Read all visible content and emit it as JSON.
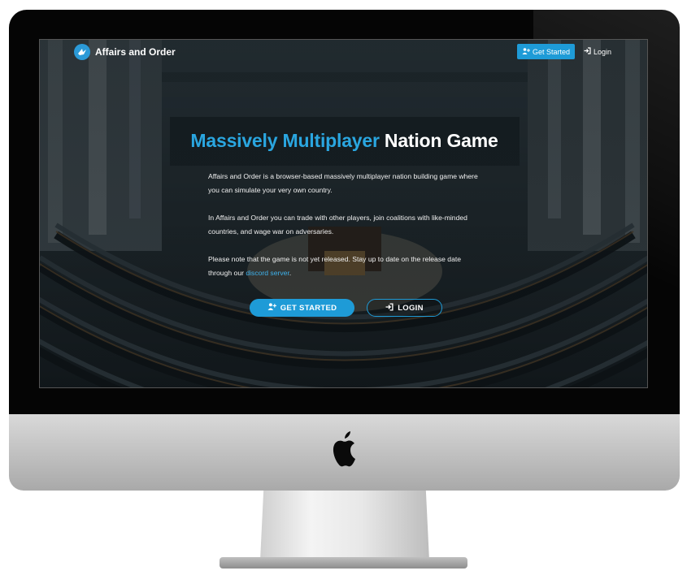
{
  "nav": {
    "brand": "Affairs and Order",
    "get_started": "Get Started",
    "login": "Login"
  },
  "hero": {
    "title_accent": "Massively Multiplayer",
    "title_rest": " Nation Game",
    "p1": "Affairs and Order is a browser-based massively multiplayer nation building game where you can simulate your very own country.",
    "p2": "In Affairs and Order you can trade with other players, join coalitions with like-minded countries, and wage war on adversaries.",
    "p3_before": "Please note that the game is not yet released. Stay up to date on the release date through our ",
    "p3_link": "discord server",
    "p3_after": ".",
    "cta_get_started": "GET STARTED",
    "cta_login": "LOGIN"
  },
  "icons": {
    "brand": "dove-logo-icon",
    "get_started": "user-plus-icon",
    "login": "sign-in-icon",
    "hardware": "apple-logo-icon"
  },
  "colors": {
    "accent": "#1e9bd7",
    "title_accent": "#2aa6e0"
  }
}
